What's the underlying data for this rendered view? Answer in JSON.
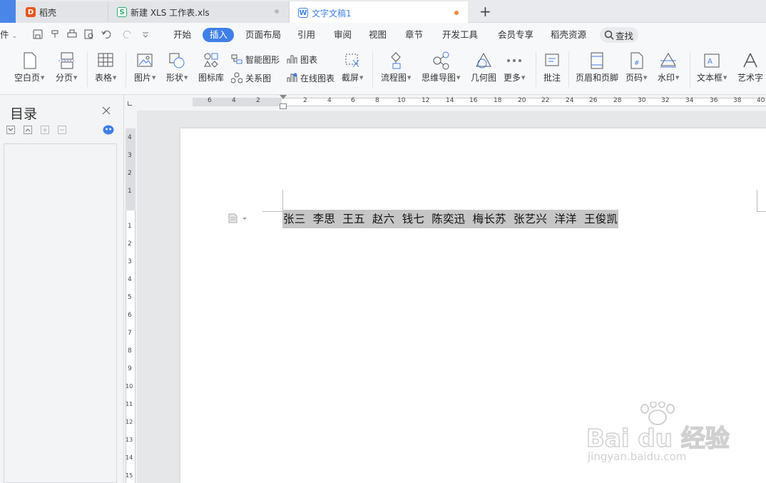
{
  "tabs": [
    {
      "label": "稻壳",
      "icon": "docer-icon",
      "active": false
    },
    {
      "label": "新建 XLS 工作表.xls",
      "icon": "spreadsheet-icon",
      "active": false
    },
    {
      "label": "文字文稿1",
      "icon": "writer-icon",
      "active": true
    }
  ],
  "new_tab_label": "+",
  "menu": {
    "file_partial": "件",
    "items": [
      "开始",
      "插入",
      "页面布局",
      "引用",
      "审阅",
      "视图",
      "章节",
      "开发工具",
      "会员专享",
      "稻壳资源"
    ],
    "active": "插入",
    "search_label": "查找"
  },
  "ribbon": {
    "blank_page": "空白页",
    "page_break": "分页",
    "table": "表格",
    "picture": "图片",
    "shape": "形状",
    "icon_lib": "图标库",
    "smart_art": "智能图形",
    "relation": "关系图",
    "chart": "图表",
    "online_chart": "在线图表",
    "screenshot": "截屏",
    "flowchart": "流程图",
    "mindmap": "思维导图",
    "geometry": "几何图",
    "more": "更多",
    "comment": "批注",
    "header_footer": "页眉和页脚",
    "page_number": "页码",
    "watermark": "水印",
    "textbox": "文本框",
    "wordart": "艺术字"
  },
  "sidebar": {
    "title": "目录"
  },
  "hruler": {
    "left_nums": [
      "6",
      "4",
      "2"
    ],
    "right_nums": [
      "2",
      "4",
      "6",
      "8",
      "10",
      "12",
      "14",
      "16",
      "18",
      "20",
      "22",
      "24",
      "26",
      "28",
      "30",
      "32",
      "34",
      "36",
      "38",
      "40"
    ]
  },
  "vruler": {
    "top_nums": [
      "4",
      "3",
      "2",
      "1"
    ],
    "bottom_nums": [
      "1",
      "2",
      "3",
      "4",
      "5",
      "6",
      "7",
      "8",
      "9",
      "10",
      "11",
      "12",
      "13",
      "14",
      "15"
    ]
  },
  "document": {
    "line1": "张三  李思  王五  赵六  钱七  陈奕迅  梅长苏  张艺兴  洋洋  王俊凯"
  },
  "watermark": {
    "brand": "Bai du 经验",
    "url": "jingyan.baidu.com"
  },
  "colors": {
    "accent": "#3f7fe8",
    "selection": "#c6c6c6"
  }
}
